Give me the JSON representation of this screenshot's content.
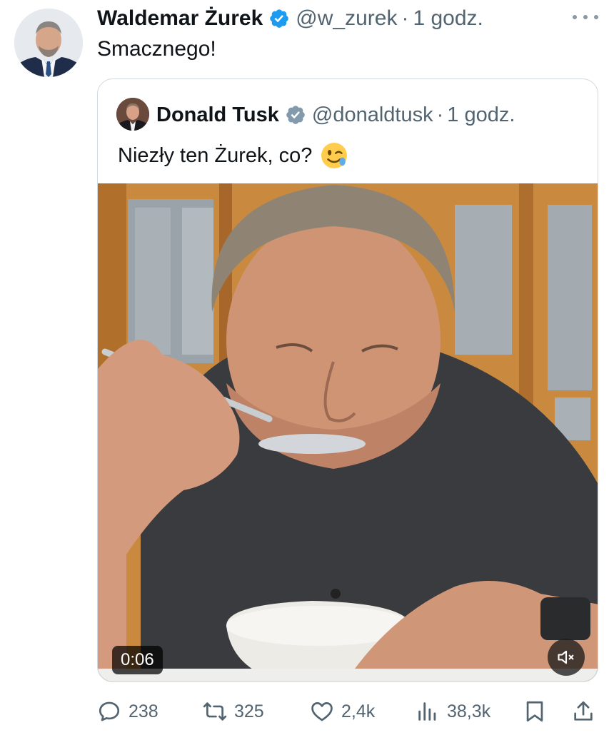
{
  "tweet": {
    "author_name": "Waldemar Żurek",
    "handle": "@w_zurek",
    "separator": "·",
    "time": "1 godz.",
    "text": "Smacznego!"
  },
  "quoted": {
    "author_name": "Donald Tusk",
    "handle": "@donaldtusk",
    "separator": "·",
    "time": "1 godz.",
    "text": "Niezły ten Żurek, co?",
    "emoji": "winking-face",
    "video_duration": "0:06"
  },
  "actions": {
    "replies": "238",
    "reposts": "325",
    "likes": "2,4k",
    "views": "38,3k"
  },
  "colors": {
    "verified": "#1d9bf0",
    "quoted_verified": "#829aab",
    "secondary_text": "#536471",
    "border": "#cfd9de"
  },
  "icons": [
    "verified-badge-icon",
    "more-options-icon",
    "mute-icon",
    "reply-icon",
    "repost-icon",
    "like-icon",
    "views-icon",
    "bookmark-icon",
    "share-icon"
  ]
}
